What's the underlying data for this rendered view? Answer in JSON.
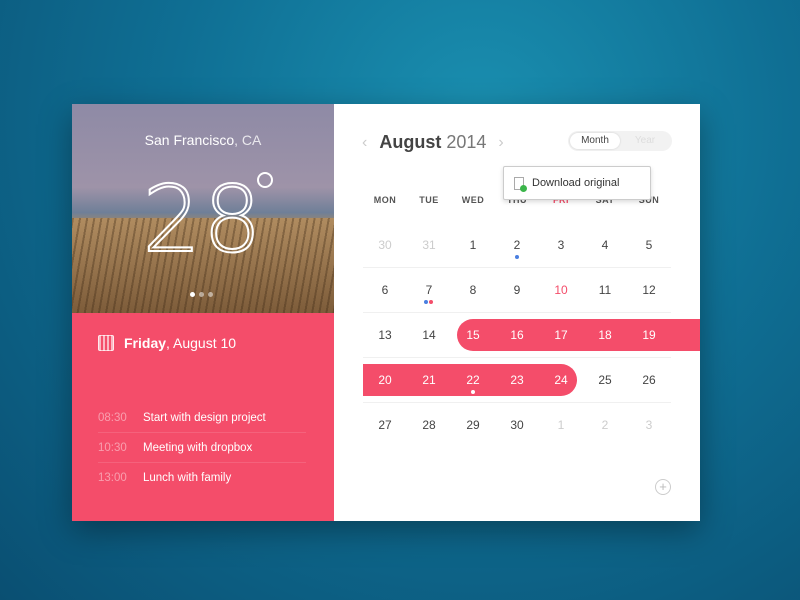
{
  "weather": {
    "city": "San Francisco",
    "state": ", CA",
    "temperature": "28",
    "page_dots": 3,
    "active_dot": 0
  },
  "day": {
    "weekday": "Friday",
    "date": ", August 10"
  },
  "events": [
    {
      "time": "08:30",
      "title": "Start with design project"
    },
    {
      "time": "10:30",
      "title": "Meeting with dropbox"
    },
    {
      "time": "13:00",
      "title": "Lunch with family"
    }
  ],
  "calendar": {
    "month": "August",
    "year": "2014",
    "view_options": [
      "Month",
      "Year"
    ],
    "selected_view": "Month",
    "weekdays": [
      "MON",
      "TUE",
      "WED",
      "THU",
      "FRI",
      "SAT",
      "SUN"
    ],
    "weeks": [
      [
        "30",
        "31",
        "1",
        "2",
        "3",
        "4",
        "5"
      ],
      [
        "6",
        "7",
        "8",
        "9",
        "10",
        "11",
        "12"
      ],
      [
        "13",
        "14",
        "15",
        "16",
        "17",
        "18",
        "19"
      ],
      [
        "20",
        "21",
        "22",
        "23",
        "24",
        "25",
        "26"
      ],
      [
        "27",
        "28",
        "29",
        "30",
        "1",
        "2",
        "3"
      ]
    ],
    "selected_range": "15 – 24",
    "today": "10"
  },
  "popup": {
    "label": "Download original"
  },
  "colors": {
    "accent": "#f44d6a",
    "event_blue": "#4a7fe0"
  }
}
